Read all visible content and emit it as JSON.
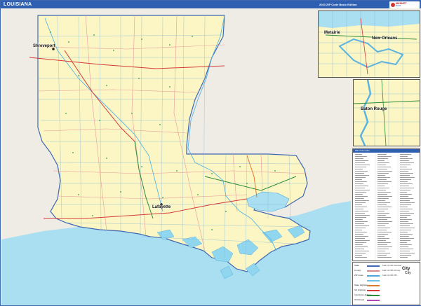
{
  "header": {
    "title": "LOUISIANA",
    "edition": "2023 ZIP Code Basic Edition",
    "logo_line1": "MARKET",
    "logo_line2": "MAPS",
    "brand_color": "#2f5fb0"
  },
  "map": {
    "cities": {
      "shreveport": "Shreveport",
      "lafayette": "Lafayette"
    },
    "colors": {
      "land_louisiana": "#fbf6c4",
      "land_neighbors": "#efece6",
      "water": "#a9dff0",
      "coast_water": "#8fd6ee",
      "county_boundary": "#e99a9a",
      "zip_boundary": "#7db0d6",
      "highway": "#d33a3a"
    }
  },
  "insets": {
    "new_orleans": {
      "labels": [
        "Metairie",
        "New Orleans"
      ]
    },
    "baton_rouge": {
      "labels": [
        "Baton Rouge"
      ]
    }
  },
  "index": {
    "header": "ZIP Code Index"
  },
  "legend": {
    "rows": [
      {
        "label": "State",
        "sample": "Stab 123 456 Interstate",
        "color": "#3f67b1"
      },
      {
        "label": "County",
        "sample": "Stab 123 456 US Hwy",
        "color": "#d88b8b"
      },
      {
        "label": "ZIP Code",
        "sample": "Stab 123 456 789",
        "color": "#4aa7d8"
      },
      {
        "label": "",
        "sample": "",
        "color": "#6cc0e8"
      },
      {
        "label": "State Highway",
        "sample": "",
        "color": "#e17a2c"
      },
      {
        "label": "US Highway",
        "sample": "",
        "color": "#d33a3a"
      },
      {
        "label": "Interstate Highway",
        "sample": "",
        "color": "#2d8c3c"
      },
      {
        "label": "Toll Roads",
        "sample": "",
        "color": "#b04ab8"
      }
    ],
    "city_label": "City",
    "city_small": "City"
  }
}
